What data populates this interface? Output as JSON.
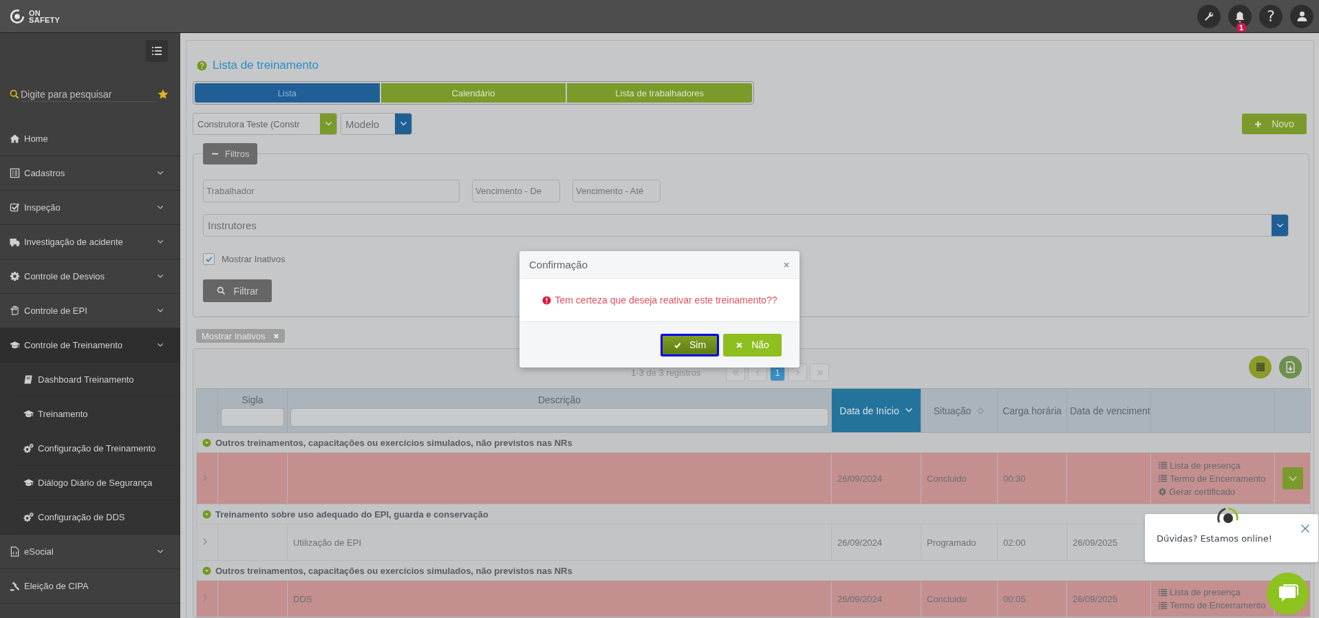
{
  "header": {
    "logo": [
      "ON",
      "SAFETY"
    ],
    "help": "?",
    "notification_count": "1"
  },
  "sidebar": {
    "search": {
      "placeholder": "Digite para pesquisar"
    },
    "items": [
      {
        "label": "Home",
        "expandable": false,
        "expanded": false
      },
      {
        "label": "Cadastros",
        "expandable": true,
        "expanded": false
      },
      {
        "label": "Inspeção",
        "expandable": true,
        "expanded": false
      },
      {
        "label": "Investigação de acidente",
        "expandable": true,
        "expanded": false
      },
      {
        "label": "Controle de Desvios",
        "expandable": true,
        "expanded": false
      },
      {
        "label": "Controle de EPI",
        "expandable": true,
        "expanded": false
      },
      {
        "label": "Controle de Treinamento",
        "expandable": true,
        "expanded": true,
        "children": [
          {
            "label": "Dashboard Treinamento"
          },
          {
            "label": "Treinamento"
          },
          {
            "label": "Configuração de Treinamento"
          },
          {
            "label": "Diálogo Diário de Segurança"
          },
          {
            "label": "Configuração de DDS"
          }
        ]
      },
      {
        "label": "eSocial",
        "expandable": true,
        "expanded": false
      },
      {
        "label": "Eleição de CIPA",
        "expandable": false,
        "expanded": false
      }
    ]
  },
  "page": {
    "title": "Lista de treinamento",
    "tabs": [
      {
        "label": "Lista",
        "selected": true
      },
      {
        "label": "Calendário",
        "selected": false
      },
      {
        "label": "Lista de trabalhadores",
        "selected": false
      }
    ],
    "selects": [
      {
        "value": "Construtora Teste (Constr"
      },
      {
        "placeholder": "Modelo"
      }
    ],
    "new_button": "Novo",
    "filters": {
      "toggle": "Filtros",
      "expanded": true,
      "fields": [
        {
          "placeholder": "Trabalhador"
        },
        {
          "placeholder": "Vencimento - De"
        },
        {
          "placeholder": "Vencimento - Até"
        }
      ],
      "instructors": {
        "placeholder": "Instrutores"
      },
      "show_inactive": {
        "label": "Mostrar Inativos",
        "checked": true
      },
      "filter_button": "Filtrar"
    },
    "active_tags": [
      {
        "label": "Mostrar Inativos"
      }
    ],
    "table": {
      "summary": "1-3 de 3 registros",
      "pages": [
        {
          "label": "1",
          "selected": true
        }
      ],
      "columns": [
        {
          "label": "Sigla",
          "filter": true
        },
        {
          "label": "Descrição",
          "filter": true
        },
        {
          "label": "Data de Início",
          "sortable": true,
          "sorted": true
        },
        {
          "label": "Situação",
          "sortable": true,
          "sorted": false
        },
        {
          "label": "Carga horária"
        },
        {
          "label": "Data de venciment"
        }
      ],
      "groups": [
        {
          "title": "Outros treinamentos, capacitações ou exercícios simulados, não previstos nas NRs",
          "rows": [
            {
              "start_date": "26/09/2024",
              "status": "Concluido",
              "workload": "00:30",
              "inactive": true,
              "actions": [
                {
                  "label": "Lista de presença",
                  "kind": "list"
                },
                {
                  "label": "Termo de Encerramento",
                  "kind": "list"
                },
                {
                  "label": "Gerar certificado",
                  "kind": "certificate"
                }
              ]
            }
          ]
        },
        {
          "title": "Treinamento sobre uso adequado do EPI, guarda e conservação",
          "rows": [
            {
              "description": "Utilização de EPI",
              "start_date": "26/09/2024",
              "status": "Programado",
              "workload": "02:00",
              "due_date": "26/09/2025",
              "inactive": false
            }
          ]
        },
        {
          "title": "Outros treinamentos, capacitações ou exercícios simulados, não previstos nas NRs",
          "rows": [
            {
              "description": "DDS",
              "start_date": "26/09/2024",
              "status": "Concluido",
              "workload": "00:05",
              "due_date": "26/09/2025",
              "inactive": true,
              "actions": [
                {
                  "label": "Lista de presença",
                  "kind": "list"
                },
                {
                  "label": "Termo de Encerramento",
                  "kind": "list"
                }
              ]
            }
          ]
        }
      ]
    }
  },
  "modal": {
    "title": "Confirmação",
    "message": "Tem certeza que deseja reativar este treinamento??",
    "buttons": [
      {
        "label": "Sim",
        "kind": "confirm",
        "focused": true
      },
      {
        "label": "Não",
        "kind": "cancel",
        "focused": false
      }
    ]
  },
  "chat": {
    "message": "Dúvidas? Estamos online!"
  }
}
